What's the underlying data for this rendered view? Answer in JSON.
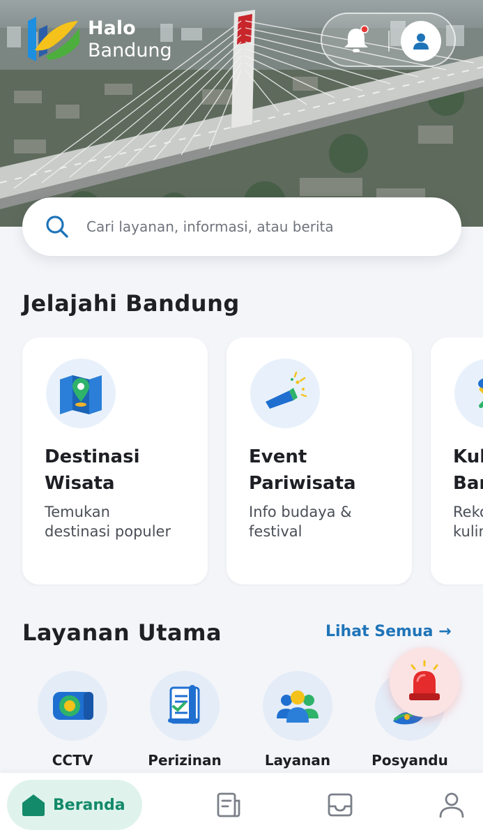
{
  "app": {
    "logo_line1": "Halo",
    "logo_line2": "Bandung",
    "accent_color": "#1f74b8",
    "home_active_color": "#138a6a"
  },
  "header": {
    "notification_icon": "bell-icon",
    "has_unread_notification": true,
    "profile_icon": "user-icon"
  },
  "search": {
    "placeholder": "Cari layanan, informasi, atau berita",
    "icon": "search-icon"
  },
  "explore": {
    "title": "Jelajahi Bandung",
    "cards": [
      {
        "title": "Destinasi\nWisata",
        "desc": "Temukan\ndestinasi populer",
        "icon": "map-pin-icon"
      },
      {
        "title": "Event\nPariwisata",
        "desc": "Info budaya &\nfestival",
        "icon": "party-popper-icon"
      },
      {
        "title": "Kul\nBar",
        "desc": "Reko\nkulin",
        "icon": "culinary-icon"
      }
    ]
  },
  "services": {
    "title": "Layanan Utama",
    "see_all": "Lihat Semua →",
    "items": [
      {
        "label": "CCTV",
        "icon": "cctv-camera-icon"
      },
      {
        "label": "Perizinan",
        "icon": "permit-document-icon"
      },
      {
        "label": "Layanan",
        "icon": "people-group-icon"
      },
      {
        "label": "Posyandu",
        "icon": "posyandu-icon"
      }
    ],
    "sos_icon": "emergency-siren-icon"
  },
  "bottom_nav": {
    "home_label": "Beranda",
    "items": [
      "home-icon",
      "news-icon",
      "inbox-icon",
      "profile-icon"
    ]
  }
}
